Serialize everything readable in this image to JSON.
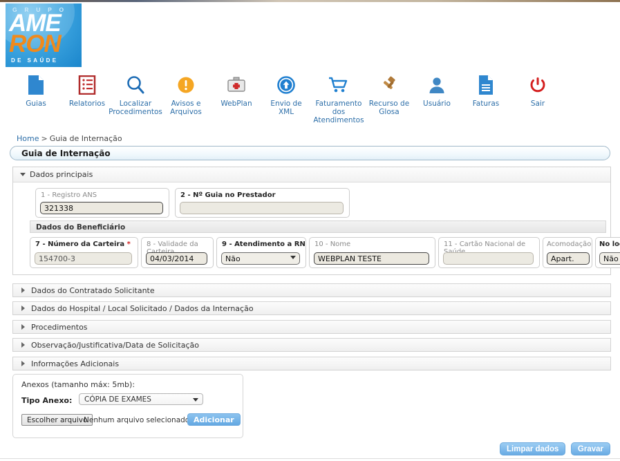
{
  "brand": {
    "grupo": "G R U P O",
    "ame": "AME",
    "ron": "RON",
    "de_saude": "DE SAÚDE",
    "accent_blue": "#1b86cc",
    "accent_orange": "#f08a1c"
  },
  "nav": {
    "items": [
      {
        "icon": "document-page-icon",
        "label": "Guias"
      },
      {
        "icon": "report-list-icon",
        "label": "Relatorios"
      },
      {
        "icon": "magnifier-icon",
        "label": "Localizar\nProcedimentos"
      },
      {
        "icon": "warning-alert-icon",
        "label": "Avisos e\nArquivos"
      },
      {
        "icon": "medical-kit-icon",
        "label": "WebPlan"
      },
      {
        "icon": "upload-arrow-icon",
        "label": "Envio de\nXML"
      },
      {
        "icon": "shopping-cart-icon",
        "label": "Faturamento\ndos\nAtendimentos"
      },
      {
        "icon": "gavel-icon",
        "label": "Recurso de\nGlosa"
      },
      {
        "icon": "user-person-icon",
        "label": "Usuário"
      },
      {
        "icon": "invoice-document-icon",
        "label": "Faturas"
      },
      {
        "icon": "power-off-icon",
        "label": "Sair"
      }
    ]
  },
  "breadcrumb": {
    "home": "Home",
    "separator": ">",
    "current": "Guia de Internação"
  },
  "page_title": "Guia de Internação",
  "main_panel": {
    "header": "Dados principais",
    "expanded": true,
    "fields_row1": [
      {
        "label": "1 - Registro ANS",
        "value": "321338",
        "bold": false
      },
      {
        "label": "2 - Nº Guia no Prestador",
        "value": "",
        "bold": true
      }
    ],
    "beneficiary_bar": "Dados do Beneficiário",
    "fields_row2": [
      {
        "label": "7 - Número da Carteira",
        "required": true,
        "bold": true,
        "value": "154700-3",
        "type": "text"
      },
      {
        "label": "8 - Validade da Carteira",
        "required": false,
        "bold": false,
        "value": "04/03/2014",
        "type": "text"
      },
      {
        "label": "9 - Atendimento a RN",
        "required": true,
        "bold": true,
        "value": "Não",
        "type": "select"
      },
      {
        "label": "10 - Nome",
        "required": false,
        "bold": false,
        "value": "WEBPLAN TESTE",
        "type": "text"
      },
      {
        "label": "11 - Cartão Nacional de Saúde",
        "required": false,
        "bold": false,
        "value": "",
        "type": "text"
      },
      {
        "label": "Acomodação",
        "required": false,
        "bold": false,
        "value": "Apart.",
        "type": "text"
      },
      {
        "label": "No local",
        "required": false,
        "bold": true,
        "value": "Não",
        "type": "select"
      }
    ]
  },
  "sections": [
    {
      "title": "Dados do Contratado Solicitante",
      "expanded": false
    },
    {
      "title": "Dados do Hospital / Local Solicitado / Dados da Internação",
      "expanded": false
    },
    {
      "title": "Procedimentos",
      "expanded": false
    },
    {
      "title": "Observação/Justificativa/Data de Solicitação",
      "expanded": false
    },
    {
      "title": "Informações Adicionais",
      "expanded": false
    }
  ],
  "attachments": {
    "title": "Anexos (tamanho máx: 5mb):",
    "type_label": "Tipo Anexo:",
    "type_value": "CÓPIA DE EXAMES",
    "choose_file_button": "Escolher arquivo",
    "file_status": "Nenhum arquivo selecionado",
    "add_button": "Adicionar"
  },
  "footer": {
    "clear_button": "Limpar dados",
    "save_button": "Gravar"
  }
}
